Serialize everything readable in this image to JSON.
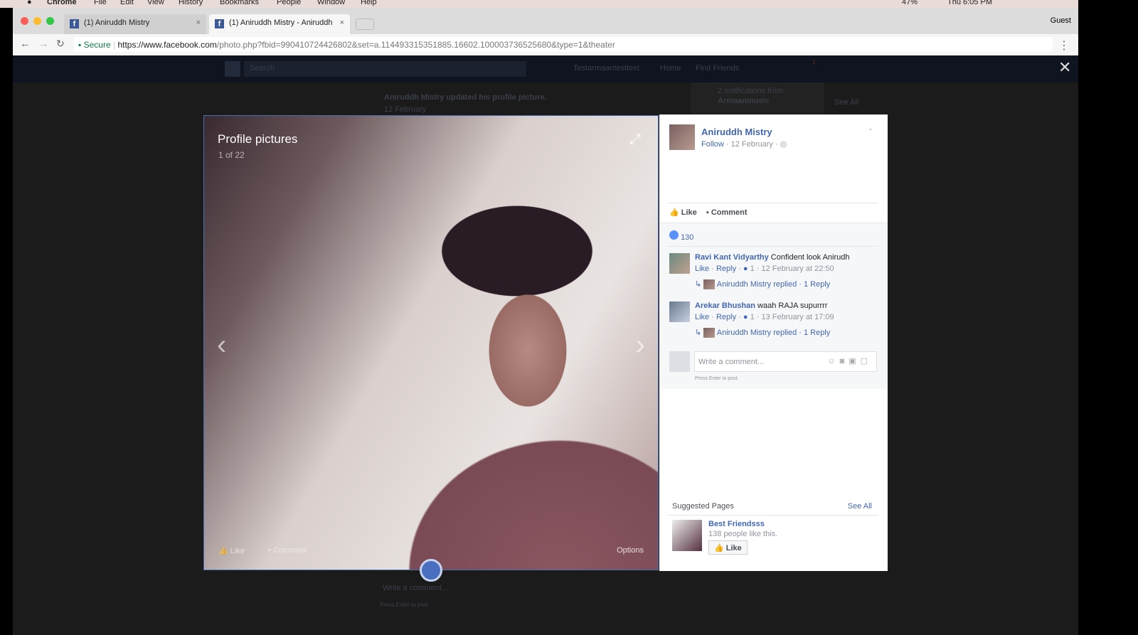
{
  "menubar": {
    "app": "Chrome",
    "items": [
      "File",
      "Edit",
      "View",
      "History",
      "Bookmarks",
      "People",
      "Window",
      "Help"
    ],
    "status": "47%",
    "clock": "Thu 6:05 PM"
  },
  "browser": {
    "tabs": [
      {
        "title": "(1) Aniruddh Mistry"
      },
      {
        "title": "(1) Aniruddh Mistry - Aniruddh"
      }
    ],
    "profile": "Guest",
    "secure": "Secure",
    "url_host": "https://www.facebook.com",
    "url_path": "/photo.php?fbid=990410724426802&set=a.114493315351885.16602.100003736525680&type=1&theater"
  },
  "fb_bg": {
    "search": "Search",
    "user": "Testarmaantesttest",
    "home": "Home",
    "find_friends": "Find Friends",
    "notif_badge": "1",
    "notification": "2 notifications from",
    "notification_from": "Armaanmusic",
    "see_all": "See All",
    "story": "Aniruddh Mistry updated his profile picture.",
    "story_date": "12 February",
    "write_comment": "Write a comment...",
    "press_enter": "Press Enter to post."
  },
  "photo": {
    "album": "Profile pictures",
    "counter": "1 of 22",
    "like": "Like",
    "comment": "Comment",
    "options": "Options"
  },
  "side": {
    "author": "Aniruddh Mistry",
    "follow": "Follow",
    "date": "· 12 February ·",
    "like": "Like",
    "comment": "Comment",
    "likes_count": "130",
    "comments": [
      {
        "name": "Ravi Kant Vidyarthy",
        "text": "Confident look Anirudh",
        "like": "Like",
        "reply": "Reply",
        "reactions": "1",
        "date": "· 12 February at 22:50",
        "reply_summary": "Aniruddh Mistry replied · 1 Reply"
      },
      {
        "name": "Arekar Bhushan",
        "text": "waah RAJA supurrrr",
        "like": "Like",
        "reply": "Reply",
        "reactions": "1",
        "date": "· 13 February at 17:09",
        "reply_summary": "Aniruddh Mistry replied · 1 Reply"
      }
    ],
    "comment_placeholder": "Write a comment...",
    "press_enter": "Press Enter to post.",
    "suggested_title": "Suggested Pages",
    "see_all": "See All",
    "page_name": "Best Friendsss",
    "page_likes": "138 people like this.",
    "page_like_button": "Like"
  }
}
